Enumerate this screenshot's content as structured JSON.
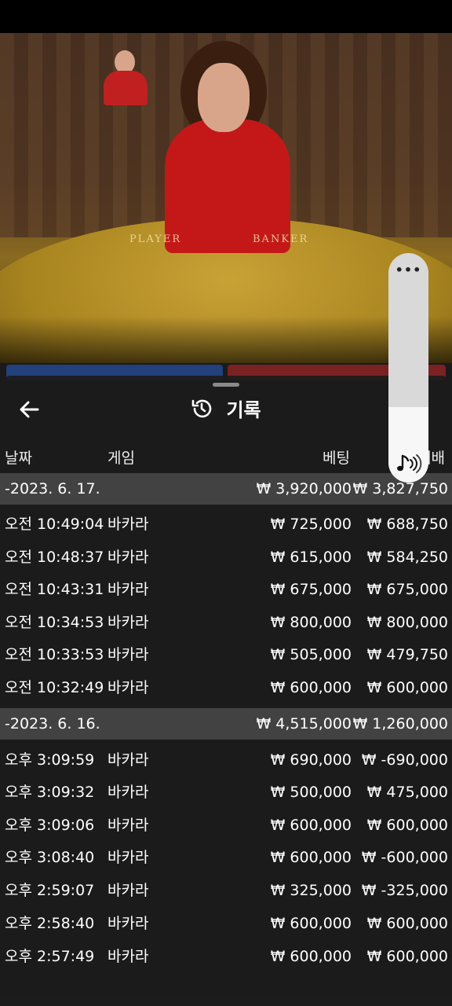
{
  "video": {
    "table_labels": {
      "player": "PLAYER",
      "banker": "BANKER"
    }
  },
  "history": {
    "title": "기록",
    "back_icon": "arrow-left-icon",
    "title_icon": "history-icon",
    "columns": {
      "date": "날짜",
      "game": "게임",
      "bet": "베팅",
      "win": "배배"
    },
    "rows": [
      {
        "kind": "date",
        "date": "-2023. 6. 17.",
        "bet": "₩ 3,920,000",
        "win": "₩ 3,827,750"
      },
      {
        "kind": "entry",
        "time": "오전 10:49:04",
        "game": "바카라",
        "bet": "₩ 725,000",
        "win": "₩ 688,750"
      },
      {
        "kind": "entry",
        "time": "오전 10:48:37",
        "game": "바카라",
        "bet": "₩ 615,000",
        "win": "₩ 584,250"
      },
      {
        "kind": "entry",
        "time": "오전 10:43:31",
        "game": "바카라",
        "bet": "₩ 675,000",
        "win": "₩ 675,000"
      },
      {
        "kind": "entry",
        "time": "오전 10:34:53",
        "game": "바카라",
        "bet": "₩ 800,000",
        "win": "₩ 800,000"
      },
      {
        "kind": "entry",
        "time": "오전 10:33:53",
        "game": "바카라",
        "bet": "₩ 505,000",
        "win": "₩ 479,750"
      },
      {
        "kind": "entry",
        "time": "오전 10:32:49",
        "game": "바카라",
        "bet": "₩ 600,000",
        "win": "₩ 600,000"
      },
      {
        "kind": "date",
        "date": "-2023. 6. 16.",
        "bet": "₩ 4,515,000",
        "win": "₩ 1,260,000"
      },
      {
        "kind": "entry",
        "time": "오후 3:09:59",
        "game": "바카라",
        "bet": "₩ 690,000",
        "win": "₩ -690,000"
      },
      {
        "kind": "entry",
        "time": "오후 3:09:32",
        "game": "바카라",
        "bet": "₩ 500,000",
        "win": "₩ 475,000"
      },
      {
        "kind": "entry",
        "time": "오후 3:09:06",
        "game": "바카라",
        "bet": "₩ 600,000",
        "win": "₩ 600,000"
      },
      {
        "kind": "entry",
        "time": "오후 3:08:40",
        "game": "바카라",
        "bet": "₩ 600,000",
        "win": "₩ -600,000"
      },
      {
        "kind": "entry",
        "time": "오후 2:59:07",
        "game": "바카라",
        "bet": "₩ 325,000",
        "win": "₩ -325,000"
      },
      {
        "kind": "entry",
        "time": "오후 2:58:40",
        "game": "바카라",
        "bet": "₩ 600,000",
        "win": "₩ 600,000"
      },
      {
        "kind": "entry",
        "time": "오후 2:57:49",
        "game": "바카라",
        "bet": "₩ 600,000",
        "win": "₩ 600,000"
      }
    ]
  },
  "volume_slider": {
    "menu_label": "•••",
    "icon": "music-note-sound-icon",
    "level": 0.33
  }
}
